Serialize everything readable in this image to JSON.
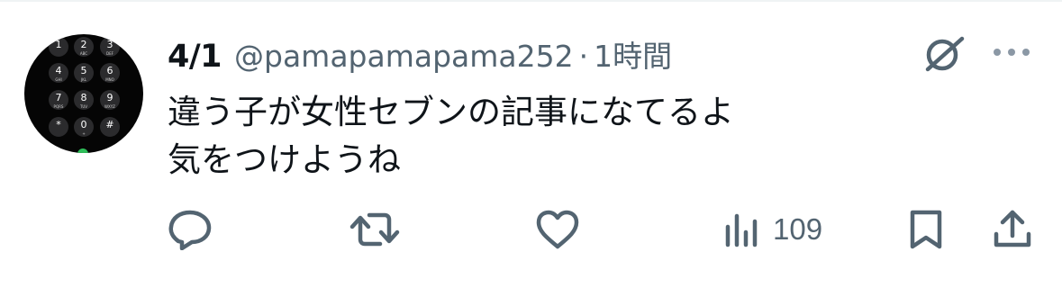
{
  "tweet": {
    "name": "4/1",
    "handle": "@pamapamapama252",
    "separator": "·",
    "time": "1時間",
    "text_lines": [
      "違う子が女性セブンの記事になてるよ",
      "気をつけようね"
    ]
  },
  "avatar": {
    "keys": [
      {
        "digit": "1",
        "letters": ""
      },
      {
        "digit": "2",
        "letters": "ABC"
      },
      {
        "digit": "3",
        "letters": "DEF"
      },
      {
        "digit": "4",
        "letters": "GHI"
      },
      {
        "digit": "5",
        "letters": "JKL"
      },
      {
        "digit": "6",
        "letters": "MNO"
      },
      {
        "digit": "7",
        "letters": "PQRS"
      },
      {
        "digit": "8",
        "letters": "TUV"
      },
      {
        "digit": "9",
        "letters": "WXYZ"
      },
      {
        "digit": "*",
        "letters": ""
      },
      {
        "digit": "0",
        "letters": "+"
      },
      {
        "digit": "#",
        "letters": ""
      }
    ]
  },
  "actions": {
    "views_count": "109"
  },
  "icons": {
    "reply": "reply-icon",
    "repost": "repost-icon",
    "like": "heart-icon",
    "views": "views-icon",
    "bookmark": "bookmark-icon",
    "share": "share-icon",
    "grok": "grok-icon",
    "more": "more-icon"
  },
  "colors": {
    "text": "#0f1419",
    "secondary": "#536471"
  }
}
